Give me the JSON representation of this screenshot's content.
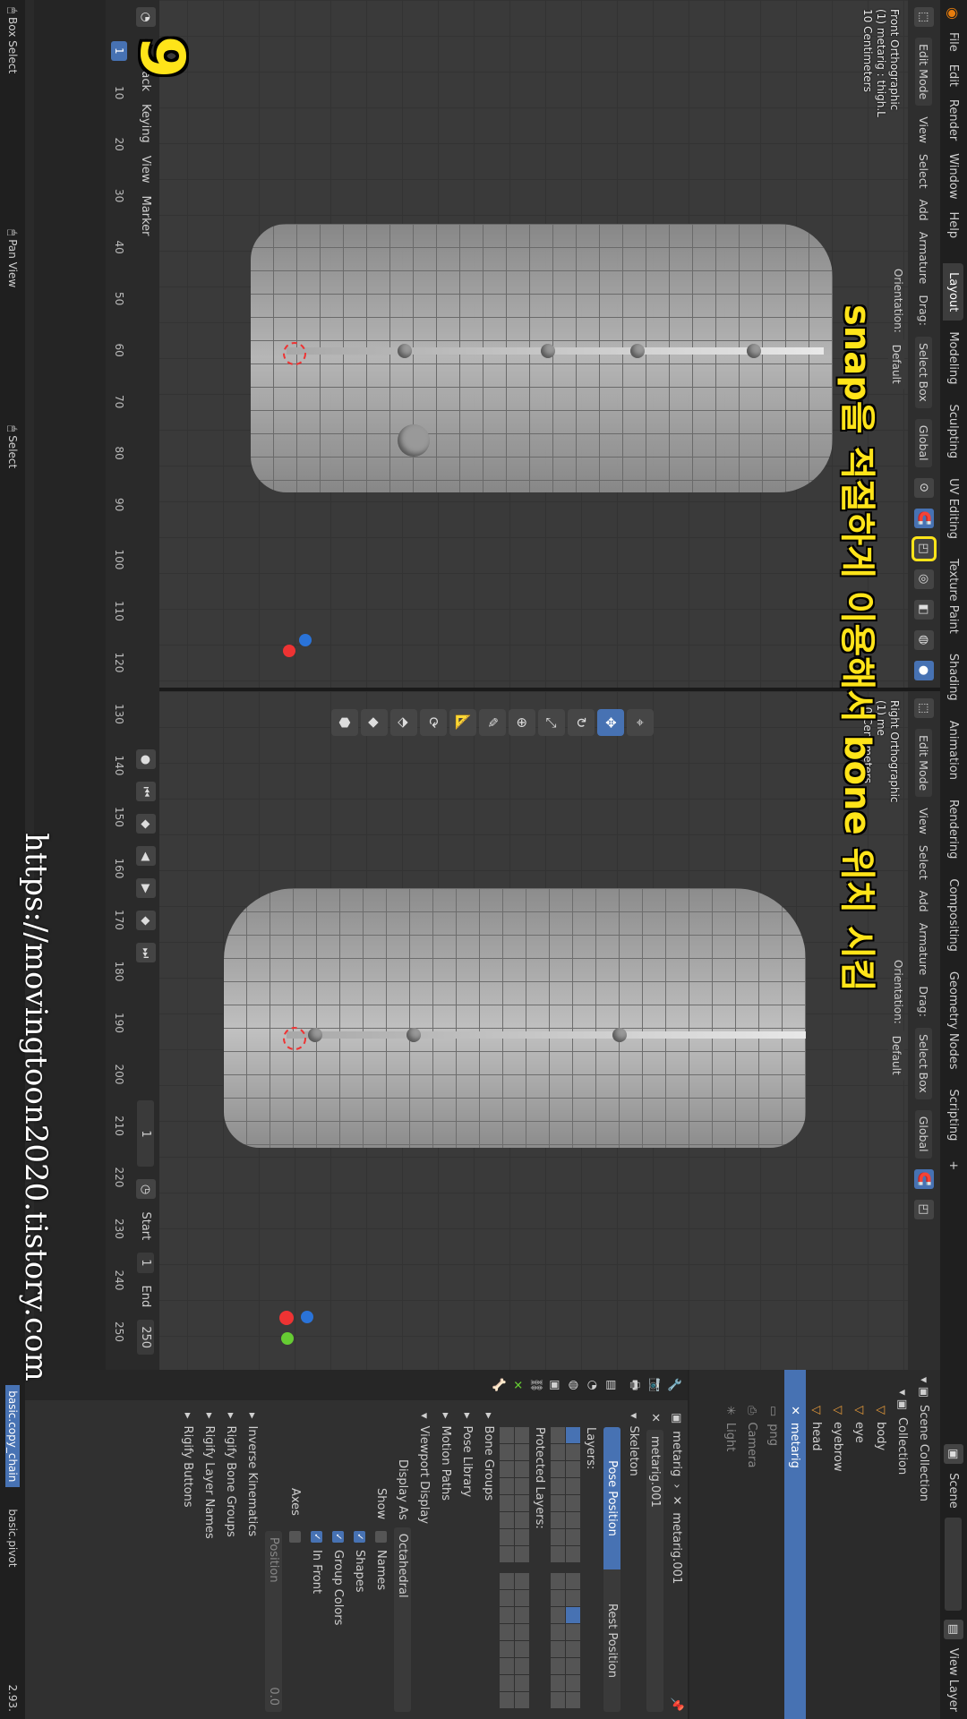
{
  "topbar": {
    "menus": [
      "File",
      "Edit",
      "Render",
      "Window",
      "Help"
    ],
    "workspaces": [
      "Layout",
      "Modeling",
      "Sculpting",
      "UV Editing",
      "Texture Paint",
      "Shading",
      "Animation",
      "Rendering",
      "Compositing",
      "Geometry Nodes",
      "Scripting"
    ],
    "active_workspace": "Layout",
    "add_tab": "+",
    "scene_label": "Scene",
    "view_layer_label": "View Layer"
  },
  "left_viewport": {
    "mode": "Edit Mode",
    "orientation_label": "Orientation:",
    "orientation_value": "Default",
    "drag_label": "Drag:",
    "drag_value": "Select Box",
    "menus": [
      "View",
      "Select",
      "Add",
      "Armature"
    ],
    "transform_value": "Global",
    "info_line1": "Front Orthographic",
    "info_line2": "(1) metarig : thigh.L",
    "info_line3": "10 Centimeters"
  },
  "right_viewport": {
    "mode": "Edit Mode",
    "orientation_label": "Orientation:",
    "orientation_value": "Default",
    "drag_label": "Drag:",
    "drag_value": "Select Box",
    "menus": [
      "View",
      "Select",
      "Add",
      "Armature"
    ],
    "transform_value": "Global",
    "info_line1": "Right Orthographic",
    "info_line2": "(1) me",
    "info_line3": "10 Centimeters"
  },
  "timeline": {
    "menus": [
      "Playback",
      "Keying",
      "View",
      "Marker"
    ],
    "current_frame": "1",
    "start_label": "Start",
    "start_value": "1",
    "end_label": "End",
    "end_value": "250",
    "ticks": [
      "10",
      "20",
      "30",
      "40",
      "50",
      "60",
      "70",
      "80",
      "90",
      "100",
      "110",
      "120",
      "130",
      "140",
      "150",
      "160",
      "170",
      "180",
      "190",
      "200",
      "210",
      "220",
      "230",
      "240",
      "250"
    ]
  },
  "statusbar": {
    "items": [
      "Box Select",
      "Pan View",
      "Select"
    ],
    "version": "2.93."
  },
  "outliner": {
    "scene_collection": "Scene Collection",
    "collection": "Collection",
    "items": [
      "body",
      "eye",
      "eyebrow",
      "head",
      "metarig",
      "png",
      "Camera",
      "Light"
    ],
    "active_item": "metarig"
  },
  "properties": {
    "object_name": "metarig",
    "data_name": "metarig.001",
    "armature_field": "metarig.001",
    "skeleton_label": "Skeleton",
    "pose_position": "Pose Position",
    "rest_position": "Rest Position",
    "layers_label": "Layers:",
    "protected_layers_label": "Protected Layers:",
    "sections": [
      "Bone Groups",
      "Pose Library",
      "Motion Paths"
    ],
    "viewport_display": "Viewport Display",
    "display_as_label": "Display As",
    "display_as_value": "Octahedral",
    "show_label": "Show",
    "show_options": [
      "Names",
      "Shapes",
      "Group Colors",
      "In Front"
    ],
    "show_checked": [
      false,
      true,
      true,
      true
    ],
    "axes_label": "Axes",
    "position_label": "Position",
    "position_value": "0.0",
    "more_sections": [
      "Inverse Kinematics",
      "Rigify Bone Groups",
      "Rigify Layer Names",
      "Rigify Buttons"
    ],
    "left_chain_1": "basic.copy_chain",
    "left_chain_2": "basic.pivot"
  },
  "overlays": {
    "step_number": "9",
    "subtitle": "snap을 적절하게 이용해서 bone 위치 시킴",
    "watermark": "https://movingtoon2020.tistory.com"
  },
  "colors": {
    "accent": "#4772b3",
    "subtitle": "#ffe419",
    "highlight_box": "#ffe419"
  }
}
